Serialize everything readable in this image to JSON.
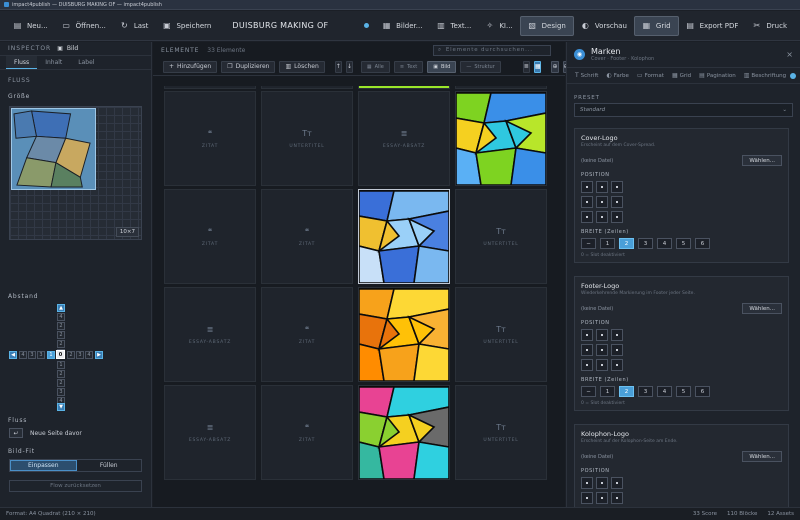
{
  "window": {
    "title": "impact4publish — DUISBURG MAKING OF — impact4publish"
  },
  "toolbar": {
    "new": "Neu...",
    "open": "Öffnen...",
    "last": "Last",
    "save": "Speichern",
    "project_title": "DUISBURG MAKING OF",
    "images": "Bilder...",
    "text": "Text...",
    "ki": "KI...",
    "design": "Design",
    "preview": "Vorschau",
    "grid": "Grid",
    "export_pdf": "Export PDF",
    "print": "Druck"
  },
  "inspector": {
    "header": "INSPECTOR",
    "kind": "Bild",
    "tabs": [
      "Fluss",
      "Inhalt",
      "Label"
    ],
    "flow_section": "FLUSS",
    "size_label": "Größe",
    "size_badge": "10×7",
    "spacing_label": "Abstand",
    "spacing": {
      "top": [
        "4",
        "2",
        "2",
        "2",
        "1"
      ],
      "left": [
        "4",
        "3",
        "3"
      ],
      "center": "0",
      "right": [
        "2",
        "3",
        "4"
      ],
      "bottom": [
        "1",
        "2",
        "2",
        "3",
        "4"
      ],
      "highlight": "1"
    },
    "flow_label": "Fluss",
    "flow_option": "Neue Seite davor",
    "fit_label": "Bild-Fit",
    "fit_options": [
      "Einpassen",
      "Füllen"
    ],
    "fit_selected": "Einpassen",
    "reset": "Flow zurücksetzen"
  },
  "elements": {
    "header": "ELEMENTE",
    "count": "33 Elemente",
    "search_placeholder": "Elemente durchsuchen...",
    "add": "Hinzufügen",
    "duplicate": "Duplizieren",
    "delete": "Löschen",
    "filters": [
      "Alle",
      "Text",
      "Bild",
      "Struktur"
    ],
    "active_filter": "Bild",
    "cards": [
      {
        "type": "quote",
        "label": "ZITAT"
      },
      {
        "type": "subtitle",
        "label": "UNTERTITEL"
      },
      {
        "type": "essay",
        "label": "ESSAY-ABSATZ"
      },
      {
        "type": "image"
      },
      {
        "type": "quote",
        "label": "ZITAT"
      },
      {
        "type": "quote",
        "label": "ZITAT"
      },
      {
        "type": "image",
        "selected": true
      },
      {
        "type": "subtitle",
        "label": "UNTERTITEL"
      },
      {
        "type": "essay",
        "label": "ESSAY-ABSATZ"
      },
      {
        "type": "quote",
        "label": "ZITAT"
      },
      {
        "type": "image"
      },
      {
        "type": "subtitle",
        "label": "UNTERTITEL"
      },
      {
        "type": "essay",
        "label": "ESSAY-ABSATZ"
      },
      {
        "type": "quote",
        "label": "ZITAT"
      },
      {
        "type": "image"
      },
      {
        "type": "subtitle",
        "label": "UNTERTITEL"
      }
    ]
  },
  "panel": {
    "title": "Marken",
    "subtitle": "Cover · Footer · Kolophon",
    "tabs": [
      "Schrift",
      "Farbe",
      "Format",
      "Grid",
      "Pagination",
      "Beschriftung"
    ],
    "preset_label": "PRESET",
    "preset_value": "Standard",
    "position_label": "POSITION",
    "width_label": "BREITE (Zeilen)",
    "choose_label": "Wählen...",
    "width_options": [
      "−",
      "1",
      "2",
      "3",
      "4",
      "5",
      "6"
    ],
    "marks": [
      {
        "title": "Cover-Logo",
        "desc": "Erscheint auf dem Cover-Spread.",
        "file": "(keine Datei)",
        "selected_width": "2",
        "note": "0 = Slot deaktiviert"
      },
      {
        "title": "Footer-Logo",
        "desc": "Wiederkehrende Markierung im Footer jeder Seite.",
        "file": "(keine Datei)",
        "selected_width": "2",
        "note": "0 = Slot deaktiviert"
      },
      {
        "title": "Kolophon-Logo",
        "desc": "Erscheint auf der Kolophon-Seite am Ende.",
        "file": "(keine Datei)"
      }
    ]
  },
  "status": {
    "format": "Format: A4 Quadrat (210 × 210)",
    "score": "33 Score",
    "blocks": "110 Blöcke",
    "assets": "12 Assets"
  }
}
